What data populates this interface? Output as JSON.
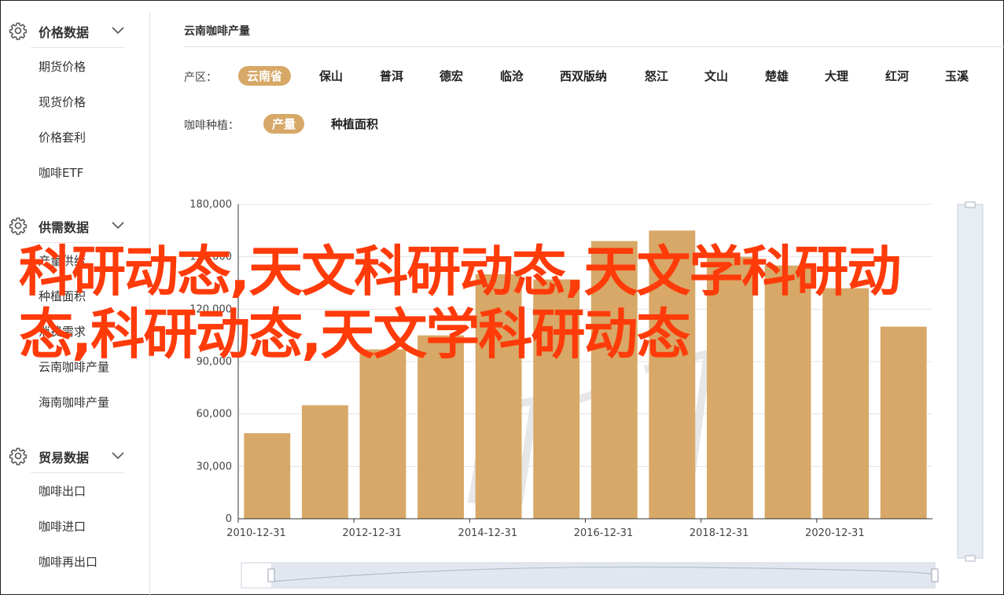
{
  "sidebar": {
    "groups": [
      {
        "title": "价格数据",
        "icon": "gear-icon",
        "items": [
          "期货价格",
          "现货价格",
          "价格套利",
          "咖啡ETF"
        ]
      },
      {
        "title": "供需数据",
        "icon": "gear-icon",
        "items": [
          "产量供给",
          "种植面积",
          "消费需求",
          "云南咖啡产量",
          "海南咖啡产量"
        ]
      },
      {
        "title": "贸易数据",
        "icon": "gear-icon",
        "items": [
          "咖啡出口",
          "咖啡进口",
          "咖啡再出口"
        ]
      }
    ]
  },
  "main": {
    "title": "云南咖啡产量",
    "region_label": "产区：",
    "regions": [
      "云南省",
      "保山",
      "普洱",
      "德宏",
      "临沧",
      "西双版纳",
      "怒江",
      "文山",
      "楚雄",
      "大理",
      "红河",
      "玉溪"
    ],
    "active_region": "云南省",
    "metric_label": "咖啡种植：",
    "metrics": [
      "产量",
      "种植面积"
    ],
    "active_metric": "产量"
  },
  "overlay_text": "科研动态,天文科研动态,天文学科研动态,科研动态,天文学科研动态",
  "colors": {
    "accent": "#d7a867",
    "bar": "#d7a867",
    "overlay": "#ff3b0a"
  },
  "chart_data": {
    "type": "bar",
    "x": [
      "2010-12-31",
      "2011-12-31",
      "2012-12-31",
      "2013-12-31",
      "2014-12-31",
      "2015-12-31",
      "2016-12-31",
      "2017-12-31",
      "2018-12-31",
      "2019-12-31",
      "2020-12-31",
      "2021-12-31"
    ],
    "x_tick_labels": [
      "2010-12-31",
      "2012-12-31",
      "2014-12-31",
      "2016-12-31",
      "2018-12-31",
      "2020-12-31"
    ],
    "values": [
      49000,
      65000,
      97000,
      105000,
      140000,
      137000,
      159000,
      165000,
      150000,
      145000,
      132000,
      110000
    ],
    "ylim": [
      0,
      180000
    ],
    "y_ticks": [
      "0",
      "30,000",
      "60,000",
      "90,000",
      "120,000",
      "150,000",
      "180,000"
    ],
    "grid": true
  }
}
